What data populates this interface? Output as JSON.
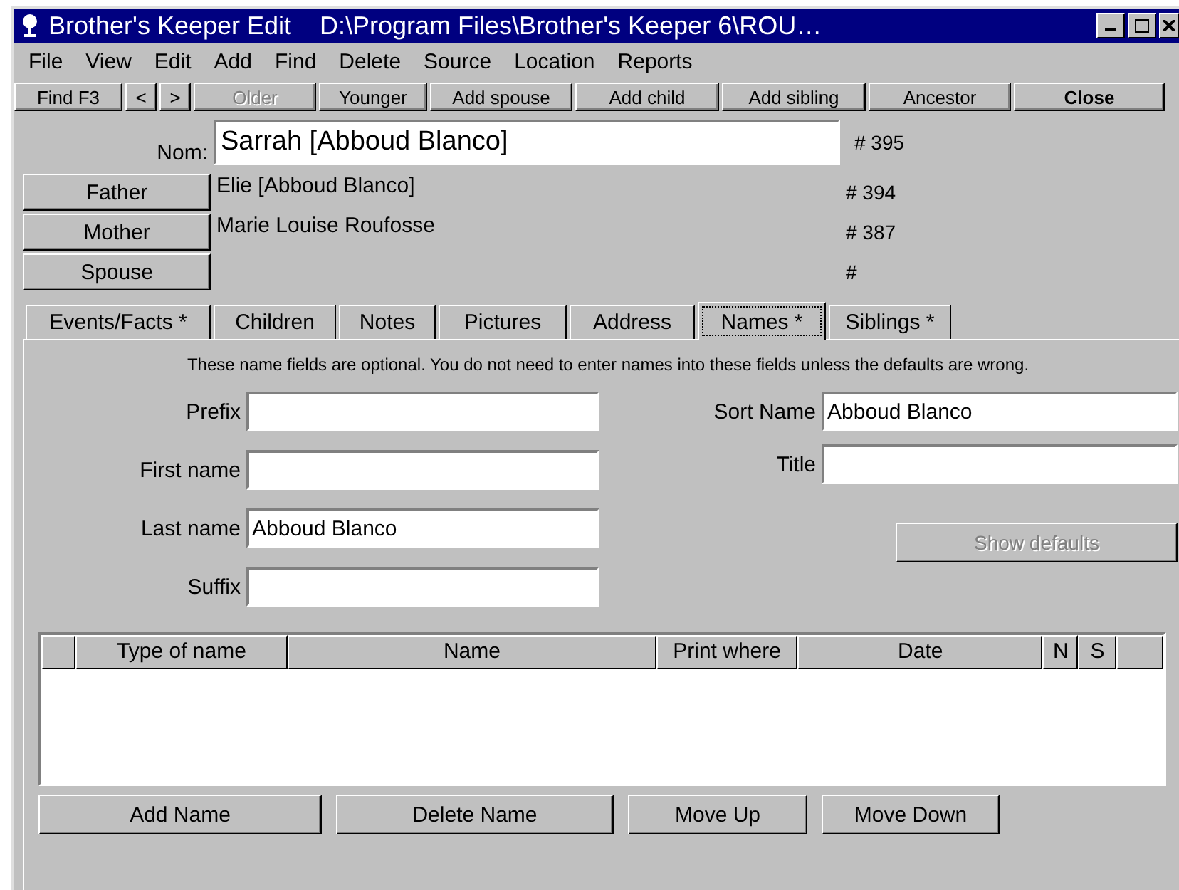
{
  "window": {
    "title": "Brother's Keeper Edit",
    "path": "D:\\Program Files\\Brother's Keeper 6\\ROU…"
  },
  "menu": [
    "File",
    "View",
    "Edit",
    "Add",
    "Find",
    "Delete",
    "Source",
    "Location",
    "Reports"
  ],
  "toolbar": [
    {
      "label": "Find  F3",
      "disabled": false,
      "default": false
    },
    {
      "label": "<",
      "disabled": false,
      "default": false
    },
    {
      "label": ">",
      "disabled": false,
      "default": false
    },
    {
      "label": "Older",
      "disabled": true,
      "default": false
    },
    {
      "label": "Younger",
      "disabled": false,
      "default": false
    },
    {
      "label": "Add spouse",
      "disabled": false,
      "default": false
    },
    {
      "label": "Add child",
      "disabled": false,
      "default": false
    },
    {
      "label": "Add sibling",
      "disabled": false,
      "default": false
    },
    {
      "label": "Ancestor",
      "disabled": false,
      "default": false
    },
    {
      "label": "Close",
      "disabled": false,
      "default": true
    }
  ],
  "person": {
    "label": "Nom:",
    "name": "Sarrah [Abboud Blanco]",
    "number": "# 395"
  },
  "relatives": [
    {
      "button": "Father",
      "name": "Elie [Abboud Blanco]",
      "number": "# 394"
    },
    {
      "button": "Mother",
      "name": "Marie Louise Roufosse",
      "number": "# 387"
    },
    {
      "button": "Spouse",
      "number": "#"
    }
  ],
  "tabs": [
    {
      "label": "Events/Facts *",
      "selected": false
    },
    {
      "label": "Children",
      "selected": false
    },
    {
      "label": "Notes",
      "selected": false
    },
    {
      "label": "Pictures",
      "selected": false
    },
    {
      "label": "Address",
      "selected": false
    },
    {
      "label": "Names *",
      "selected": true
    },
    {
      "label": "Siblings *",
      "selected": false
    }
  ],
  "info": "These name fields are optional.  You do not need to enter names into these fields unless the defaults are wrong.",
  "left_fields": [
    {
      "label": "Prefix"
    },
    {
      "label": "First name"
    },
    {
      "label": "Last name",
      "value": "Abboud Blanco"
    },
    {
      "label": "Suffix"
    }
  ],
  "right_fields": [
    {
      "label": "Sort Name",
      "value": "Abboud Blanco"
    },
    {
      "label": "Title"
    }
  ],
  "show_defaults": {
    "label": "Show defaults",
    "disabled": true
  },
  "table": {
    "columns": [
      {},
      {
        "label": "Type of name"
      },
      {
        "label": "Name"
      },
      {
        "label": "Print where"
      },
      {
        "label": "Date"
      },
      {
        "label": "N"
      },
      {
        "label": "S"
      },
      {}
    ]
  },
  "buttons": [
    {
      "label": "Add Name"
    },
    {
      "label": "Delete Name"
    },
    {
      "label": "Move Up"
    },
    {
      "label": "Move Down"
    }
  ]
}
